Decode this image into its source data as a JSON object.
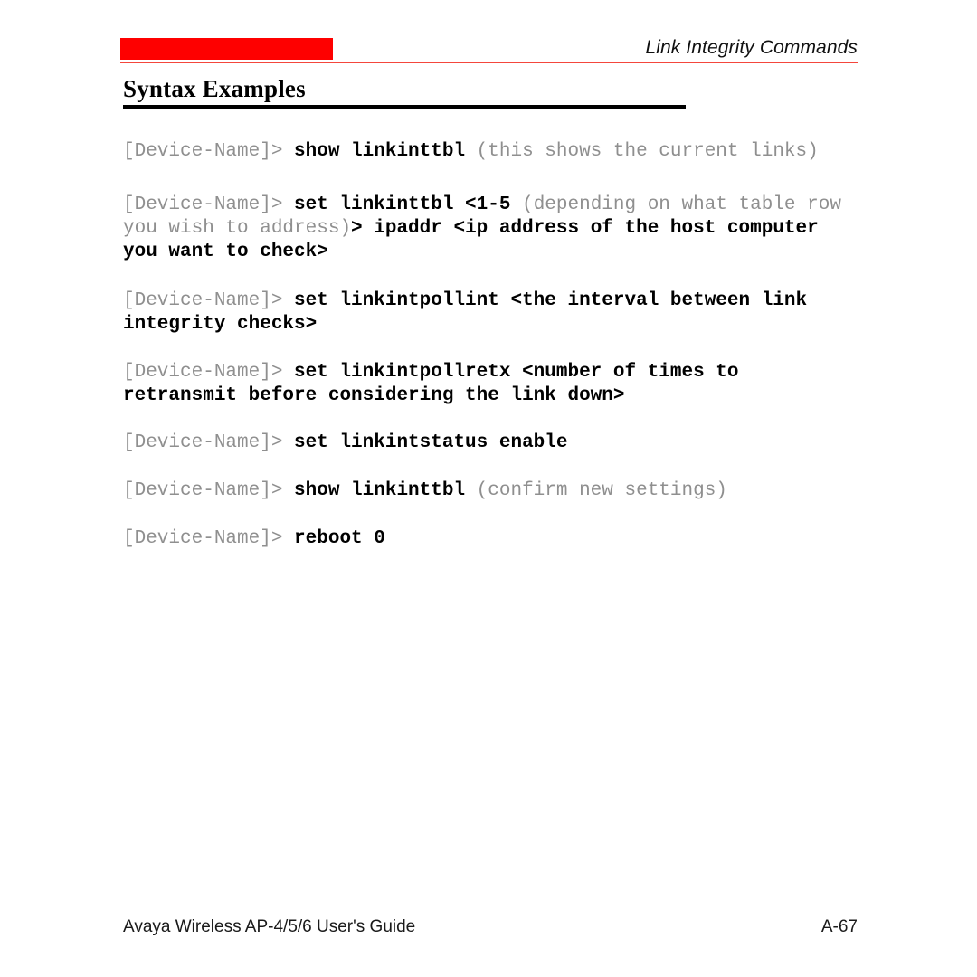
{
  "header": {
    "title": "Link Integrity Commands",
    "redbar_color": "#fe0000",
    "rule_color": "#f4463c"
  },
  "section": {
    "heading": "Syntax Examples",
    "rule_color": "#000000"
  },
  "prompt": "[Device-Name]>",
  "colors": {
    "prompt_gray": "#8f8f8f",
    "command_black": "#000000"
  },
  "commands": [
    {
      "prompt": "[Device-Name]> ",
      "command": "show linkinttbl",
      "note": " (this shows the current links)"
    },
    {
      "prompt": "[Device-Name]> ",
      "command": "set linkinttbl <1-5",
      "note": " (depending on what table row you wish to address)",
      "command2": "> ipaddr <ip address of the host computer you want to check>"
    },
    {
      "prompt": "[Device-Name]> ",
      "command": "set linkintpollint <the interval between link integrity checks>",
      "note": ""
    },
    {
      "prompt": "[Device-Name]> ",
      "command": "set linkintpollretx <number of times to retransmit before considering the link down>",
      "note": ""
    },
    {
      "prompt": "[Device-Name]> ",
      "command": "set linkintstatus enable",
      "note": ""
    },
    {
      "prompt": "[Device-Name]> ",
      "command": "show linkinttbl",
      "note": " (confirm new settings)"
    },
    {
      "prompt": "[Device-Name]> ",
      "command": "reboot 0",
      "note": ""
    }
  ],
  "footer": {
    "guide": "Avaya Wireless AP-4/5/6 User's Guide",
    "page": "A-67"
  }
}
